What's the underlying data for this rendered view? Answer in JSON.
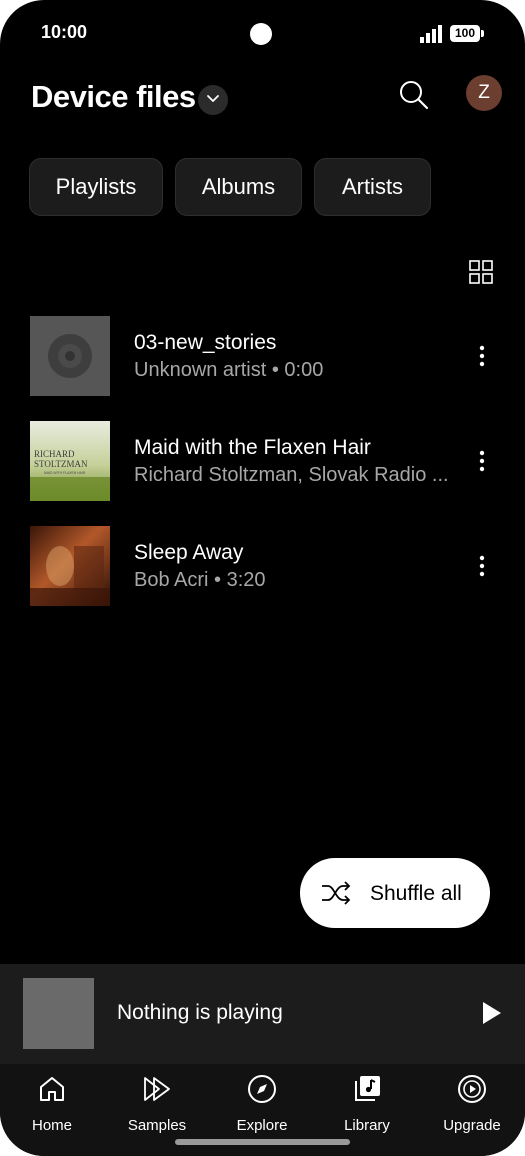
{
  "status": {
    "time": "10:00",
    "battery": "100"
  },
  "header": {
    "title": "Device files",
    "avatar_letter": "Z"
  },
  "chips": [
    {
      "label": "Playlists"
    },
    {
      "label": "Albums"
    },
    {
      "label": "Artists"
    }
  ],
  "tracks": [
    {
      "title": "03-new_stories",
      "subtitle": "Unknown artist • 0:00",
      "art": "vinyl-placeholder"
    },
    {
      "title": "Maid with the Flaxen Hair",
      "subtitle": "Richard Stoltzman, Slovak Radio ...",
      "art": "album-cover",
      "art_lines": [
        "RICHARD",
        "STOLTZMAN",
        "MAID WITH FLAXEN HAIR"
      ]
    },
    {
      "title": "Sleep Away",
      "subtitle": "Bob Acri • 3:20",
      "art": "album-cover"
    }
  ],
  "shuffle": {
    "label": "Shuffle all"
  },
  "miniplayer": {
    "text": "Nothing is playing"
  },
  "nav": [
    {
      "label": "Home",
      "icon": "home-icon"
    },
    {
      "label": "Samples",
      "icon": "samples-icon"
    },
    {
      "label": "Explore",
      "icon": "compass-icon"
    },
    {
      "label": "Library",
      "icon": "library-icon"
    },
    {
      "label": "Upgrade",
      "icon": "upgrade-icon"
    }
  ],
  "colors": {
    "background": "#000000",
    "surface": "#1c1c1c",
    "secondary_text": "#a7a7a7",
    "avatar": "#6b3e30"
  }
}
